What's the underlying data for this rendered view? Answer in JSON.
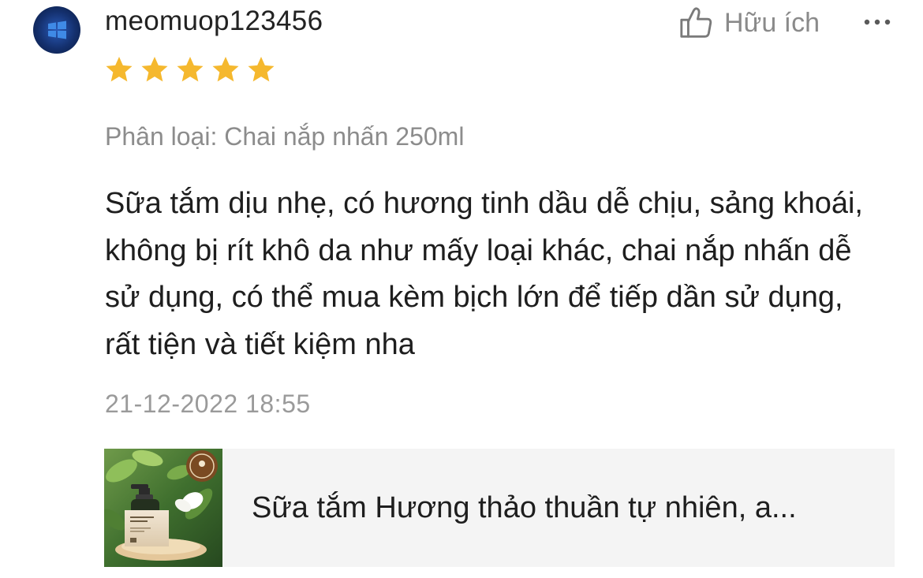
{
  "review": {
    "username": "meomuop123456",
    "rating": 5,
    "rating_max": 5,
    "helpful_label": "Hữu ích",
    "variant": "Phân loại: Chai nắp nhấn 250ml",
    "text": "Sữa tắm dịu nhẹ, có hương tinh dầu dễ chịu, sảng khoái, không bị rít khô da như mấy loại khác, chai nắp nhấn dễ sử dụng, có thể mua kèm bịch lớn để tiếp dần sử dụng, rất tiện và tiết kiệm nha",
    "timestamp": "21-12-2022 18:55"
  },
  "product": {
    "name": "Sữa tắm Hương thảo thuần tự nhiên, a..."
  },
  "icons": {
    "avatar": "windows-logo-icon",
    "helpful": "thumbs-up-icon",
    "more": "more-dots-icon",
    "star": "star-icon"
  },
  "colors": {
    "star": "#F5B82E",
    "muted_text": "#8c8c8c",
    "card_background": "#f4f4f4"
  }
}
